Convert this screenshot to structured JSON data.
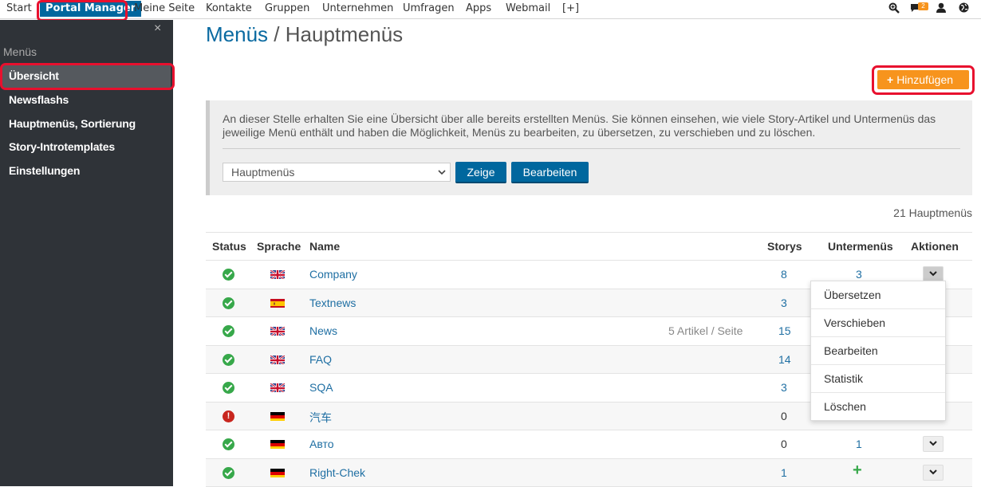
{
  "nav": {
    "items": [
      "Start",
      "Portal Manager",
      "Meine Seite",
      "Kontakte",
      "Gruppen",
      "Unternehmen",
      "Umfragen",
      "Apps",
      "Webmail",
      "[+]"
    ],
    "notifications_badge": "2"
  },
  "sidebar": {
    "close": "×",
    "section_title": "Menüs",
    "items": [
      "Übersicht",
      "Newsflashs",
      "Hauptmenüs, Sortierung",
      "Story-Introtemplates",
      "Einstellungen"
    ]
  },
  "page": {
    "title_part1": "Menüs",
    "title_sep": "/",
    "title_part2": "Hauptmenüs",
    "add_label": "Hinzufügen"
  },
  "info": {
    "text": "An dieser Stelle erhalten Sie eine Übersicht über alle bereits erstellten Menüs. Sie können einsehen, wie viele Story-Artikel und Untermenüs das jeweilige Menü enthält und haben die Möglichkeit, Menüs zu bearbeiten, zu übersetzen, zu verschieben und zu löschen.",
    "select_value": "Hauptmenüs",
    "show_button": "Zeige",
    "edit_button": "Bearbeiten"
  },
  "count_label": "21 Hauptmenüs",
  "table": {
    "headers": [
      "Status",
      "Sprache",
      "Name",
      "Storys",
      "Untermenüs",
      "Aktionen"
    ],
    "rows": [
      {
        "status": "ok",
        "flag": "uk",
        "name": "Company",
        "note": "",
        "storys": "8",
        "storys_link": true,
        "sub": "3",
        "sub_type": "link"
      },
      {
        "status": "ok",
        "flag": "es",
        "name": "Textnews",
        "note": "",
        "storys": "3",
        "storys_link": true,
        "sub": "",
        "sub_type": "hidden"
      },
      {
        "status": "ok",
        "flag": "uk",
        "name": "News",
        "note": "5 Artikel / Seite",
        "storys": "15",
        "storys_link": true,
        "sub": "",
        "sub_type": "hidden"
      },
      {
        "status": "ok",
        "flag": "uk",
        "name": "FAQ",
        "note": "",
        "storys": "14",
        "storys_link": true,
        "sub": "",
        "sub_type": "hidden"
      },
      {
        "status": "ok",
        "flag": "uk",
        "name": "SQA",
        "note": "",
        "storys": "3",
        "storys_link": true,
        "sub": "",
        "sub_type": "hidden"
      },
      {
        "status": "error",
        "flag": "de",
        "name": "汽车",
        "note": "",
        "storys": "0",
        "storys_link": false,
        "sub": "",
        "sub_type": "hidden"
      },
      {
        "status": "ok",
        "flag": "de",
        "name": "Авто",
        "note": "",
        "storys": "0",
        "storys_link": false,
        "sub": "1",
        "sub_type": "link"
      },
      {
        "status": "ok",
        "flag": "de",
        "name": "Right-Chek",
        "note": "",
        "storys": "1",
        "storys_link": true,
        "sub": "+",
        "sub_type": "plus"
      }
    ]
  },
  "dropdown": {
    "items": [
      "Übersetzen",
      "Verschieben",
      "Bearbeiten",
      "Statistik",
      "Löschen"
    ]
  },
  "colors": {
    "brand_blue": "#00679e",
    "accent_orange": "#f7941d",
    "highlight_red": "#e8102e",
    "sidebar_bg": "#2f3338"
  }
}
